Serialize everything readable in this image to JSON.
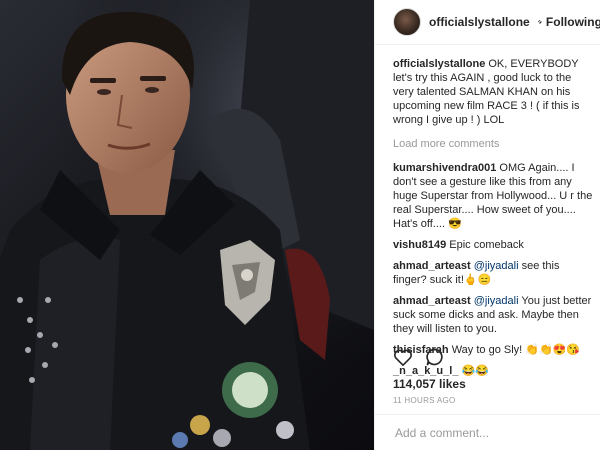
{
  "post": {
    "header": {
      "username": "officialslystallone",
      "separator": "•",
      "follow_status": "Following"
    },
    "caption": {
      "username": "officialslystallone",
      "text": "OK, EVERYBODY let's try this AGAIN , good luck to the very talented SALMAN KHAN on his upcoming new film RACE 3 ! ( if this is wrong I give up ! ) LOL"
    },
    "load_more_label": "Load more comments",
    "comments": [
      {
        "username": "kumarshivendra001",
        "mention": "",
        "text": "OMG Again.... I don't see a gesture like this from any huge Superstar from Hollywood... U r the real Superstar.... How sweet of you.... Hat's off.... 😎"
      },
      {
        "username": "vishu8149",
        "mention": "",
        "text": "Epic comeback"
      },
      {
        "username": "ahmad_arteast",
        "mention": "@jiyadali",
        "text": "see this finger? suck it!🖕😑"
      },
      {
        "username": "ahmad_arteast",
        "mention": "@jiyadali",
        "text": "You just better suck some dicks and ask. Maybe then they will listen to you."
      },
      {
        "username": "thisisfarah",
        "mention": "",
        "text": "Way to go Sly! 👏👏😍😘"
      },
      {
        "username": "_n_a_k_u_l_",
        "mention": "",
        "text": "😂😂"
      }
    ],
    "likes_text": "114,057 likes",
    "timestamp": "11 HOURS AGO",
    "add_comment_placeholder": "Add a comment...",
    "icons": {
      "like": "heart-icon",
      "comment": "comment-bubble-icon",
      "verified": "verified-badge-icon"
    },
    "colors": {
      "verified": "#3897f0",
      "mention": "#003569",
      "muted": "#999999",
      "text": "#262626"
    }
  }
}
